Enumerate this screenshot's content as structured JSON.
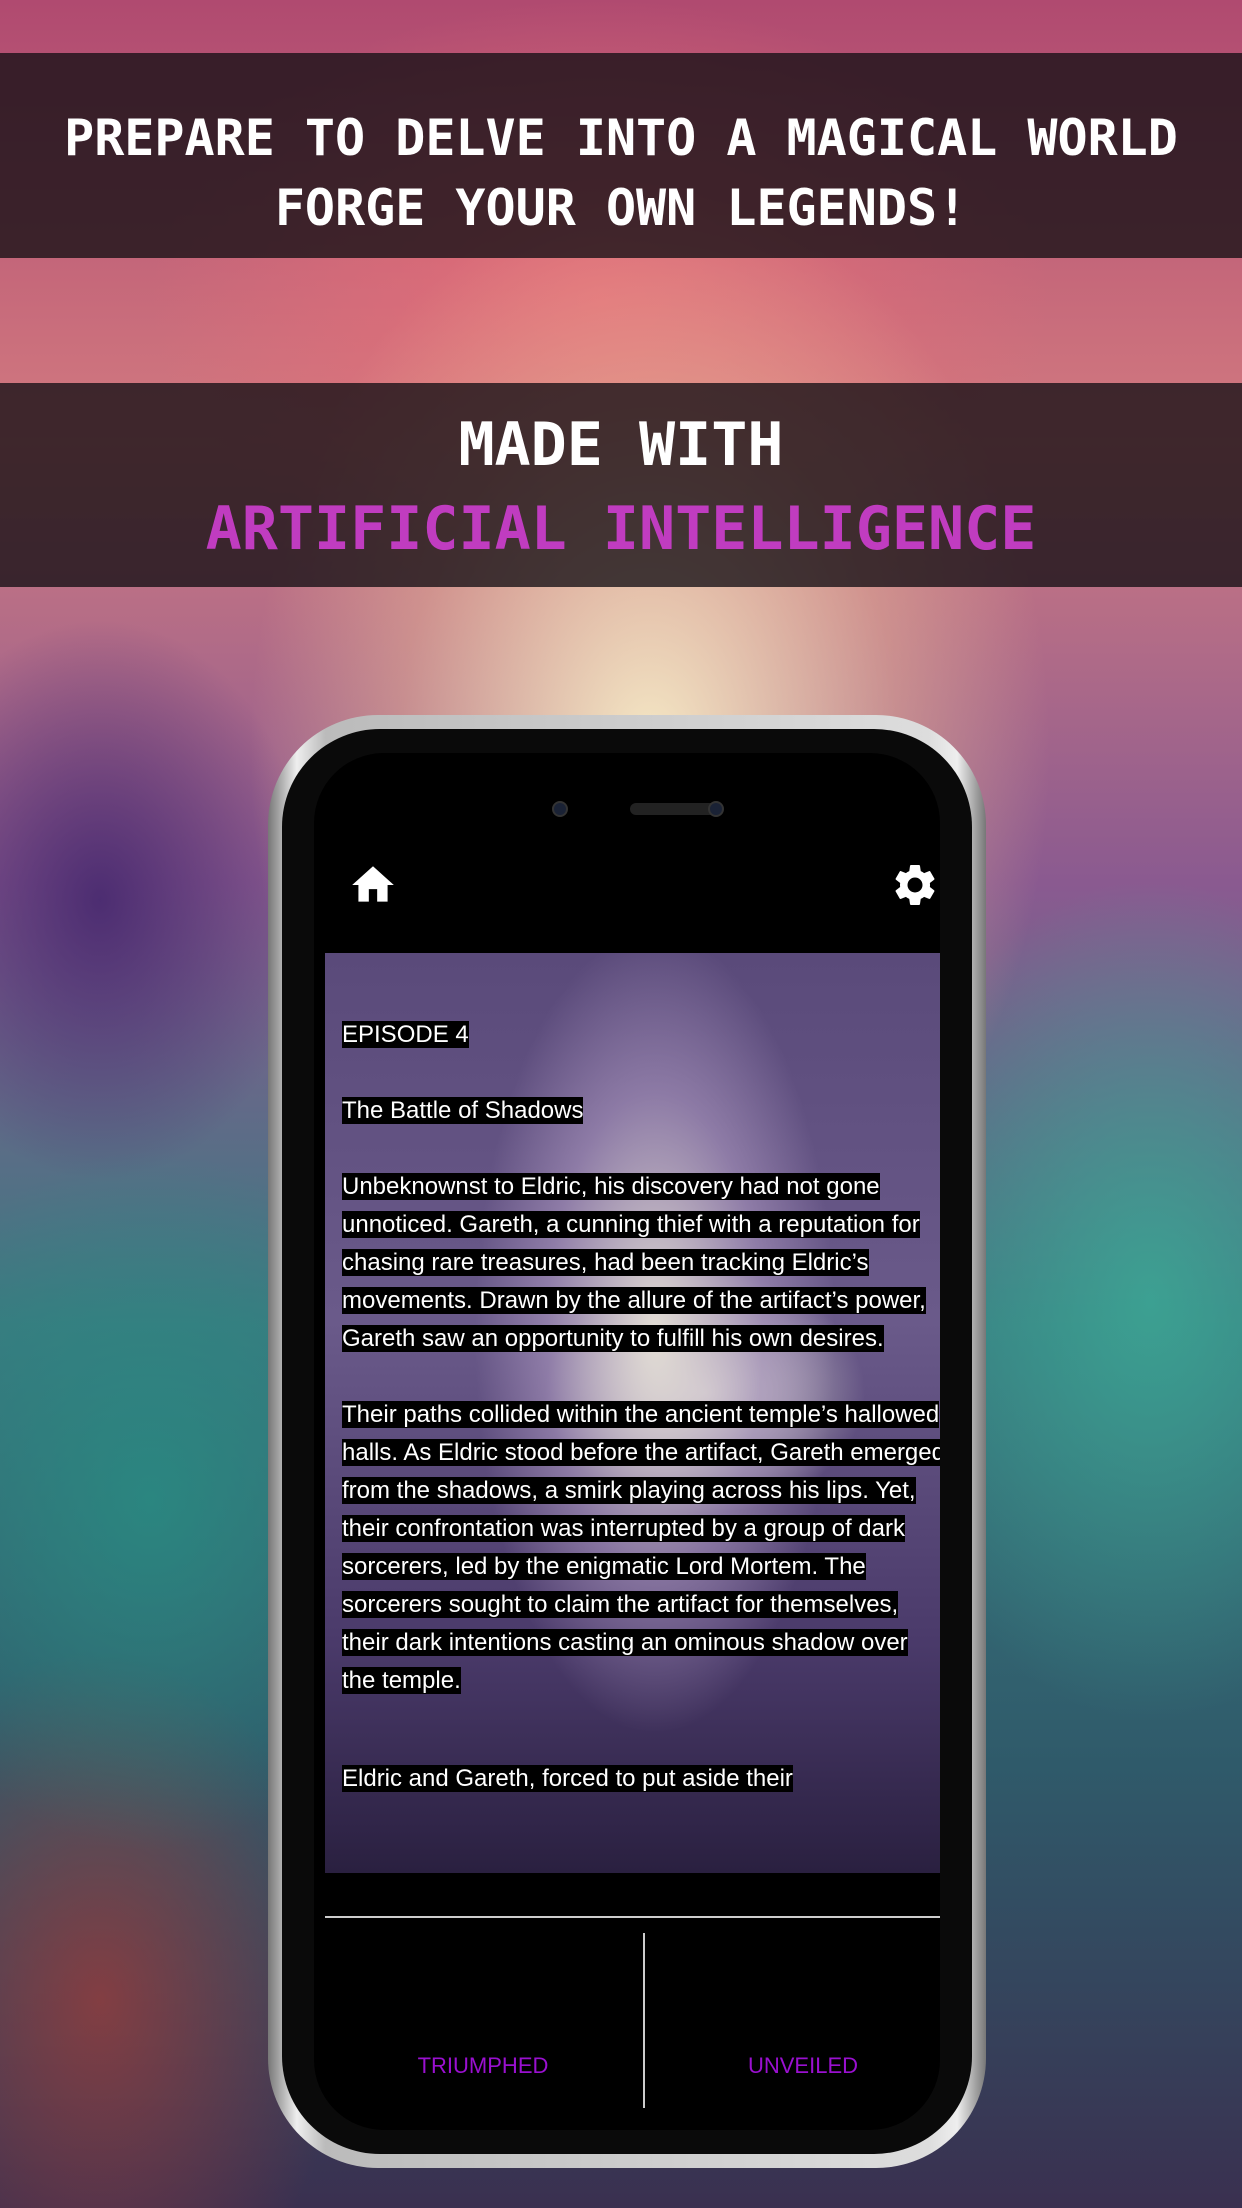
{
  "banner_top": {
    "line1": "PREPARE TO DELVE INTO A MAGICAL WORLD",
    "line2": "FORGE YOUR OWN LEGENDS!"
  },
  "banner_ai": {
    "line1": "MADE WITH",
    "line2": "ARTIFICIAL INTELLIGENCE",
    "accent_color": "#c03cc0"
  },
  "app": {
    "header": {
      "left_icon": "home-icon",
      "right_icon": "gear-icon"
    },
    "story": {
      "episode": "EPISODE 4",
      "title": "The Battle of Shadows",
      "paragraphs": [
        "Unbeknownst to Eldric, his discovery had not gone unnoticed. Gareth, a cunning thief with a reputation for chasing rare treasures, had been tracking Eldric’s movements. Drawn by the allure of the artifact’s power, Gareth saw an opportunity to fulfill his own desires.",
        "Their paths collided within the ancient temple’s hallowed halls. As Eldric stood before the artifact, Gareth emerged from the shadows, a smirk playing across his lips. Yet, their confrontation was interrupted by a group of dark sorcerers, led by the enigmatic Lord Mortem. The sorcerers sought to claim the artifact for themselves, their dark intentions casting an ominous shadow over the temple.",
        "Eldric and Gareth, forced to put aside their"
      ]
    },
    "choices": [
      {
        "label": "TRIUMPHED"
      },
      {
        "label": "UNVEILED"
      }
    ],
    "choice_color": "#9a10d0"
  }
}
